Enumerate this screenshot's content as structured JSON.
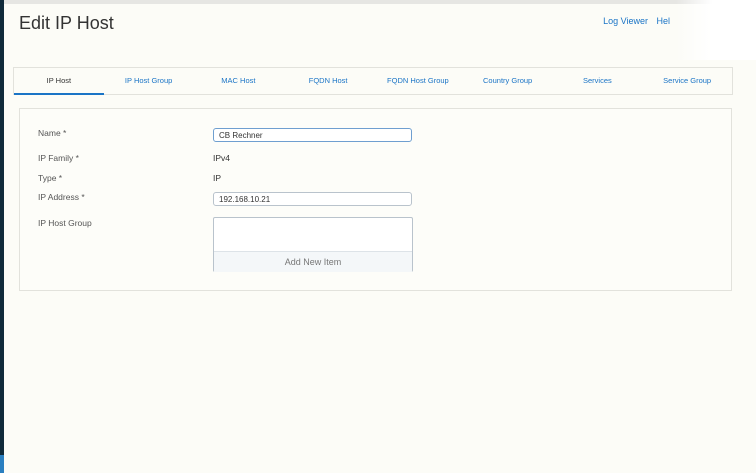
{
  "page": {
    "title": "Edit IP Host"
  },
  "header": {
    "log_viewer": "Log Viewer",
    "help": "Hel"
  },
  "tabs": [
    {
      "label": "IP Host",
      "active": true
    },
    {
      "label": "IP Host Group"
    },
    {
      "label": "MAC Host"
    },
    {
      "label": "FQDN Host"
    },
    {
      "label": "FQDN Host Group"
    },
    {
      "label": "Country Group"
    },
    {
      "label": "Services"
    },
    {
      "label": "Service Group"
    }
  ],
  "form": {
    "name": {
      "label": "Name *",
      "value": "CB Rechner"
    },
    "ip_family": {
      "label": "IP Family *",
      "value": "IPv4"
    },
    "type": {
      "label": "Type *",
      "value": "IP"
    },
    "ip_address": {
      "label": "IP Address *",
      "value": "192.168.10.21"
    },
    "ip_host_group": {
      "label": "IP Host Group",
      "add_button": "Add New Item"
    }
  },
  "colors": {
    "accent": "#1a74c6",
    "sidebar": "#102a3a",
    "background": "#fcfcf7"
  }
}
